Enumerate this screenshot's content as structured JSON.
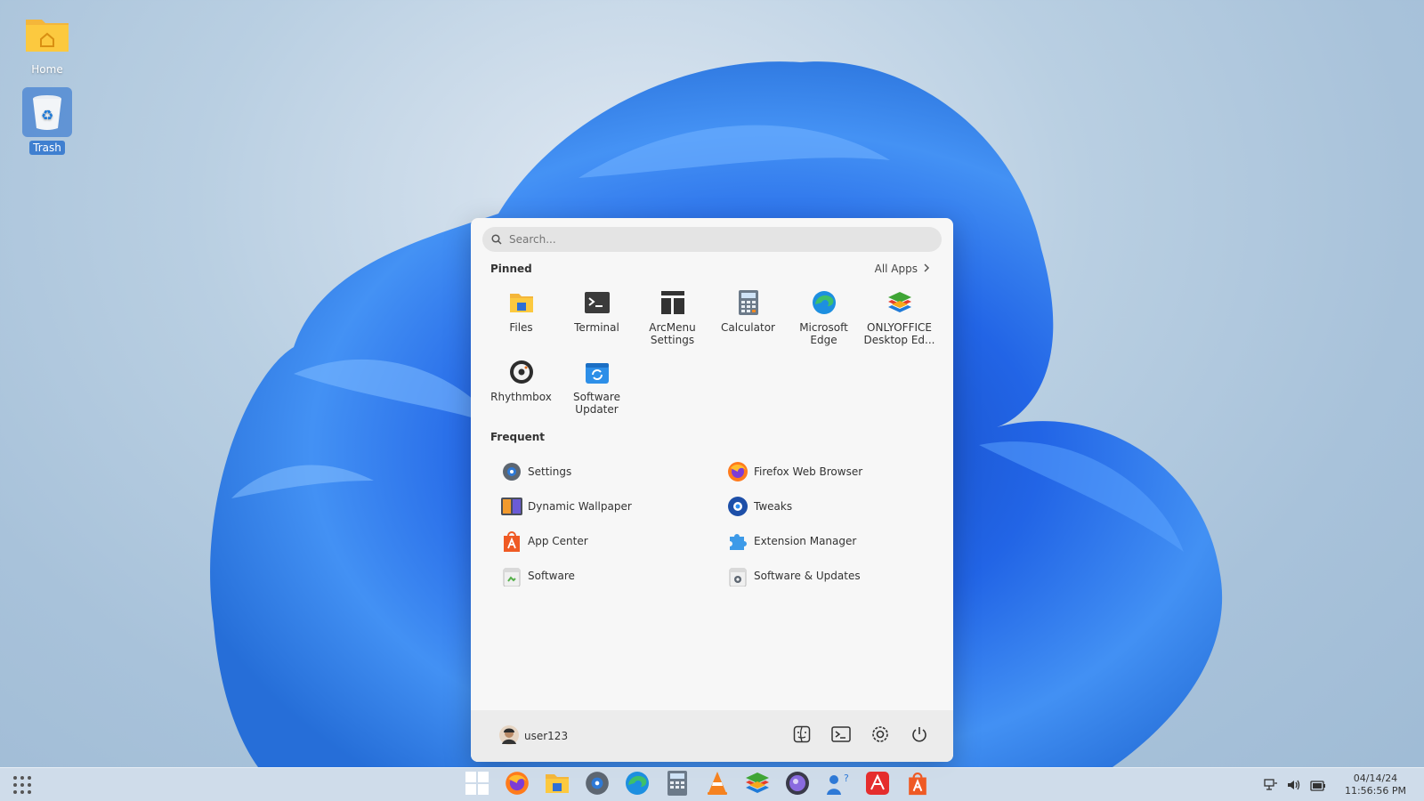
{
  "desktop": {
    "icons": [
      {
        "label": "Home"
      },
      {
        "label": "Trash"
      }
    ]
  },
  "menu": {
    "search": {
      "placeholder": "Search..."
    },
    "pinned": {
      "title": "Pinned",
      "all_apps": "All Apps",
      "apps": [
        {
          "label": "Files",
          "icon": "files-icon"
        },
        {
          "label": "Terminal",
          "icon": "terminal-icon"
        },
        {
          "label": "ArcMenu Settings",
          "icon": "arcmenu-settings-icon"
        },
        {
          "label": "Calculator",
          "icon": "calculator-icon"
        },
        {
          "label": "Microsoft Edge",
          "icon": "edge-icon"
        },
        {
          "label": "ONLYOFFICE Desktop Ed...",
          "icon": "onlyoffice-icon"
        },
        {
          "label": "Rhythmbox",
          "icon": "rhythmbox-icon"
        },
        {
          "label": "Software Updater",
          "icon": "software-updater-icon"
        }
      ]
    },
    "frequent": {
      "title": "Frequent",
      "apps": [
        {
          "label": "Settings",
          "icon": "settings-icon"
        },
        {
          "label": "Firefox Web Browser",
          "icon": "firefox-icon"
        },
        {
          "label": "Dynamic Wallpaper",
          "icon": "dynamic-wallpaper-icon"
        },
        {
          "label": "Tweaks",
          "icon": "tweaks-icon"
        },
        {
          "label": "App Center",
          "icon": "app-center-icon"
        },
        {
          "label": "Extension Manager",
          "icon": "extension-manager-icon"
        },
        {
          "label": "Software",
          "icon": "software-icon"
        },
        {
          "label": "Software & Updates",
          "icon": "software-updates-icon"
        }
      ]
    },
    "footer": {
      "username": "user123"
    }
  },
  "taskbar": {
    "apps": [
      "start",
      "firefox",
      "files",
      "settings",
      "edge",
      "calculator",
      "vlc",
      "onlyoffice",
      "screenshot",
      "help",
      "acrobat",
      "app-center"
    ],
    "clock": {
      "date": "04/14/24",
      "time": "11:56:56 PM"
    }
  },
  "colors": {
    "accent": "#3f7fd0",
    "menu_bg": "#f7f7f7",
    "taskbar_bg": "#d2deeb"
  }
}
